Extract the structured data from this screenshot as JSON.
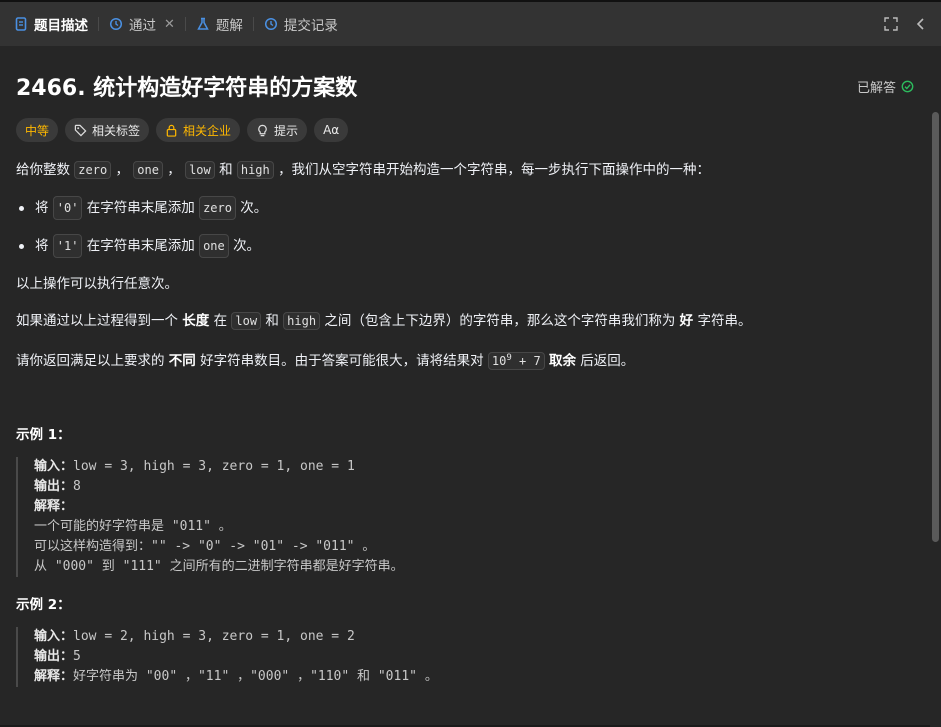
{
  "tabs": [
    {
      "label": "题目描述",
      "icon": "document-icon"
    },
    {
      "label": "通过",
      "icon": "history-icon"
    },
    {
      "label": "题解",
      "icon": "flask-icon"
    },
    {
      "label": "提交记录",
      "icon": "history-icon"
    }
  ],
  "title": "2466. 统计构造好字符串的方案数",
  "solved_label": "已解答",
  "tags": {
    "difficulty": "中等",
    "topics": "相关标签",
    "companies": "相关企业",
    "hint": "提示",
    "font": "Aα"
  },
  "desc": {
    "intro_pre": "给你整数",
    "zero": "zero",
    "comma1": "，",
    "one": "one",
    "comma2": "，",
    "low": "low",
    "and1": "和",
    "high": "high",
    "intro_post": "，我们从空字符串开始构造一个字符串，每一步执行下面操作中的一种：",
    "b1_pre": "将",
    "b1_code": "'0'",
    "b1_mid": "在字符串末尾添加",
    "b1_code2": "zero",
    "b1_post": "次。",
    "b2_pre": "将",
    "b2_code": "'1'",
    "b2_mid": "在字符串末尾添加",
    "b2_code2": "one",
    "b2_post": "次。",
    "p2": "以上操作可以执行任意次。",
    "p3_a": "如果通过以上过程得到一个",
    "p3_b": "长度",
    "p3_c": "在",
    "p3_low": "low",
    "p3_d": "和",
    "p3_high": "high",
    "p3_e": "之间（包含上下边界）的字符串，那么这个字符串我们称为",
    "p3_f": "好",
    "p3_g": "字符串。",
    "p4_a": "请你返回满足以上要求的",
    "p4_b": "不同",
    "p4_c": "好字符串数目。由于答案可能很大，请将结果对",
    "p4_mod_base": "10",
    "p4_mod_exp": "9",
    "p4_mod_rest": " + 7",
    "p4_d": "取余",
    "p4_e": "后返回。"
  },
  "examples": [
    {
      "title": "示例 1：",
      "input_key": "输入：",
      "input": "low = 3, high = 3, zero = 1, one = 1",
      "output_key": "输出：",
      "output": "8",
      "explain_key": "解释：",
      "lines": [
        "一个可能的好字符串是 \"011\" 。",
        "可以这样构造得到：\"\" -> \"0\" -> \"01\" -> \"011\" 。",
        "从 \"000\" 到 \"111\" 之间所有的二进制字符串都是好字符串。"
      ]
    },
    {
      "title": "示例 2：",
      "input_key": "输入：",
      "input": "low = 2, high = 3, zero = 1, one = 2",
      "output_key": "输出：",
      "output": "5",
      "explain_key": "解释：",
      "explain_inline": "好字符串为 \"00\" ，\"11\" ，\"000\" ，\"110\" 和 \"011\" 。"
    }
  ],
  "colors": {
    "accent_blue": "#4a90e2",
    "difficulty": "#ffb800",
    "solved_green": "#2cbb5d"
  }
}
